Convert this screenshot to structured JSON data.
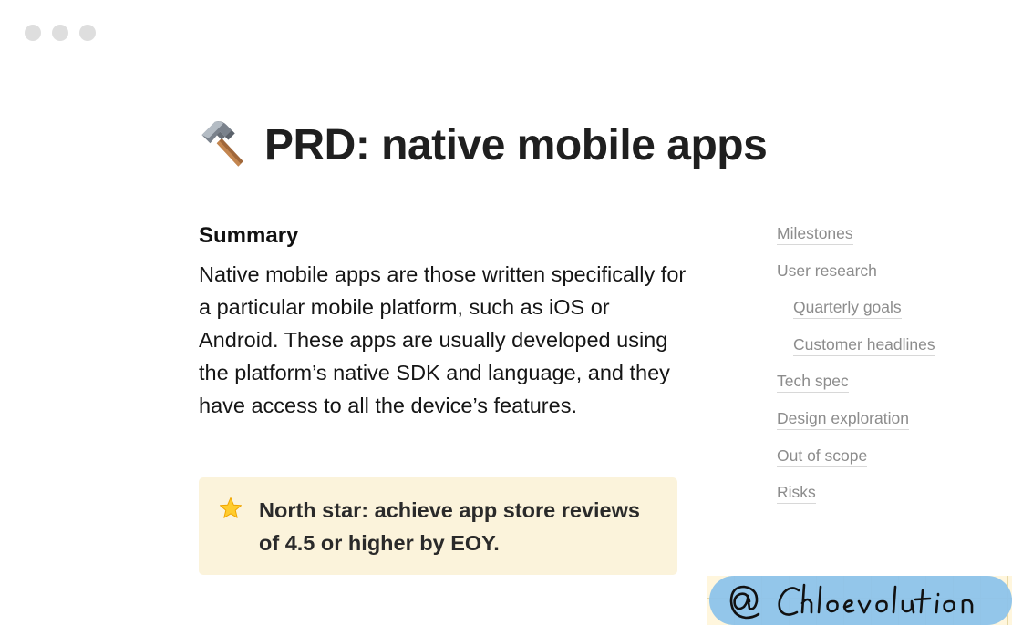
{
  "window": {
    "controls": [
      "close",
      "minimize",
      "maximize"
    ]
  },
  "page": {
    "icon": "hammer-icon",
    "title": "PRD: native mobile apps"
  },
  "summary": {
    "heading": "Summary",
    "body": "Native mobile apps are those written specifically for a particular mobile platform, such as iOS or Android. These apps are usually developed using the platform’s native SDK and language, and they have access to all the device’s features."
  },
  "callout": {
    "icon": "star-icon",
    "text": "North star: achieve app store reviews of 4.5 or higher by EOY.",
    "background": "#fbf3db"
  },
  "toc": {
    "items": [
      {
        "label": "Milestones"
      },
      {
        "label": "User research"
      },
      {
        "label": "Quarterly goals"
      },
      {
        "label": "Customer headlines"
      },
      {
        "label": "Tech spec"
      },
      {
        "label": "Design exploration"
      },
      {
        "label": "Out of scope"
      },
      {
        "label": "Risks"
      }
    ]
  },
  "watermark": {
    "text": "@ Chloevolution"
  },
  "colors": {
    "toc_text": "#8c8c8c",
    "title_text": "#1f1f1f",
    "watermark_bg": "#8dc3ea"
  }
}
